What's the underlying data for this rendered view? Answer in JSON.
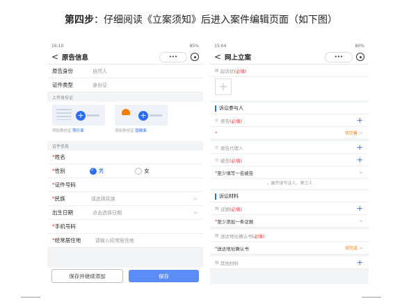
{
  "caption": {
    "step": "第四步",
    "text": "：仔细阅读《立案须知》后进入案件编辑页面（如下图）"
  },
  "left": {
    "status_time": "16:10",
    "status_right": "85%",
    "title": "原告信息",
    "pill_dots": "•••",
    "rows_top": [
      {
        "label": "原告身份",
        "value": "自然人"
      },
      {
        "label": "证件类型",
        "value": "身份证"
      }
    ],
    "upload_section": "上传身份证",
    "upload_cards": [
      {
        "text": "添加身份证",
        "link": "照片面"
      },
      {
        "text": "添加身份证",
        "link": "国徽面"
      }
    ],
    "id_section": "证件信息",
    "name_label": "姓名",
    "gender_label": "性别",
    "gender_male": "男",
    "gender_female": "女",
    "idno_label": "证件号码",
    "ethnic_label": "民族",
    "ethnic_value": "请选择民族",
    "birth_label": "出生日期",
    "birth_value": "点击选择日期",
    "phone_label": "手机号码",
    "addr_label": "经常居住地",
    "addr_value": "请输入经常居住地",
    "btn_save_continue": "保存并继续添加",
    "btn_save": "保存"
  },
  "right": {
    "status_time": "15:04",
    "status_right": "80%",
    "title": "网上立案",
    "pill_dots": "•••",
    "complaint": "起诉状",
    "required": "(必填)",
    "participants_heading": "诉讼参与人",
    "plaintiff": "原告",
    "plaintiff_status": "待完善",
    "plaintiff_agent": "原告代理人",
    "defendant": "被告",
    "defendant_hint": "至少填写一名被告",
    "expand_text": "展开填写证人、第三人",
    "materials_heading": "诉讼材料",
    "evidence": "证据",
    "evidence_hint": "至少添加一条证据",
    "service_confirm": "送达地址确认书",
    "service_confirm_label": "送达地址确认书",
    "service_status": "待完成",
    "other_materials": "其他材料"
  }
}
